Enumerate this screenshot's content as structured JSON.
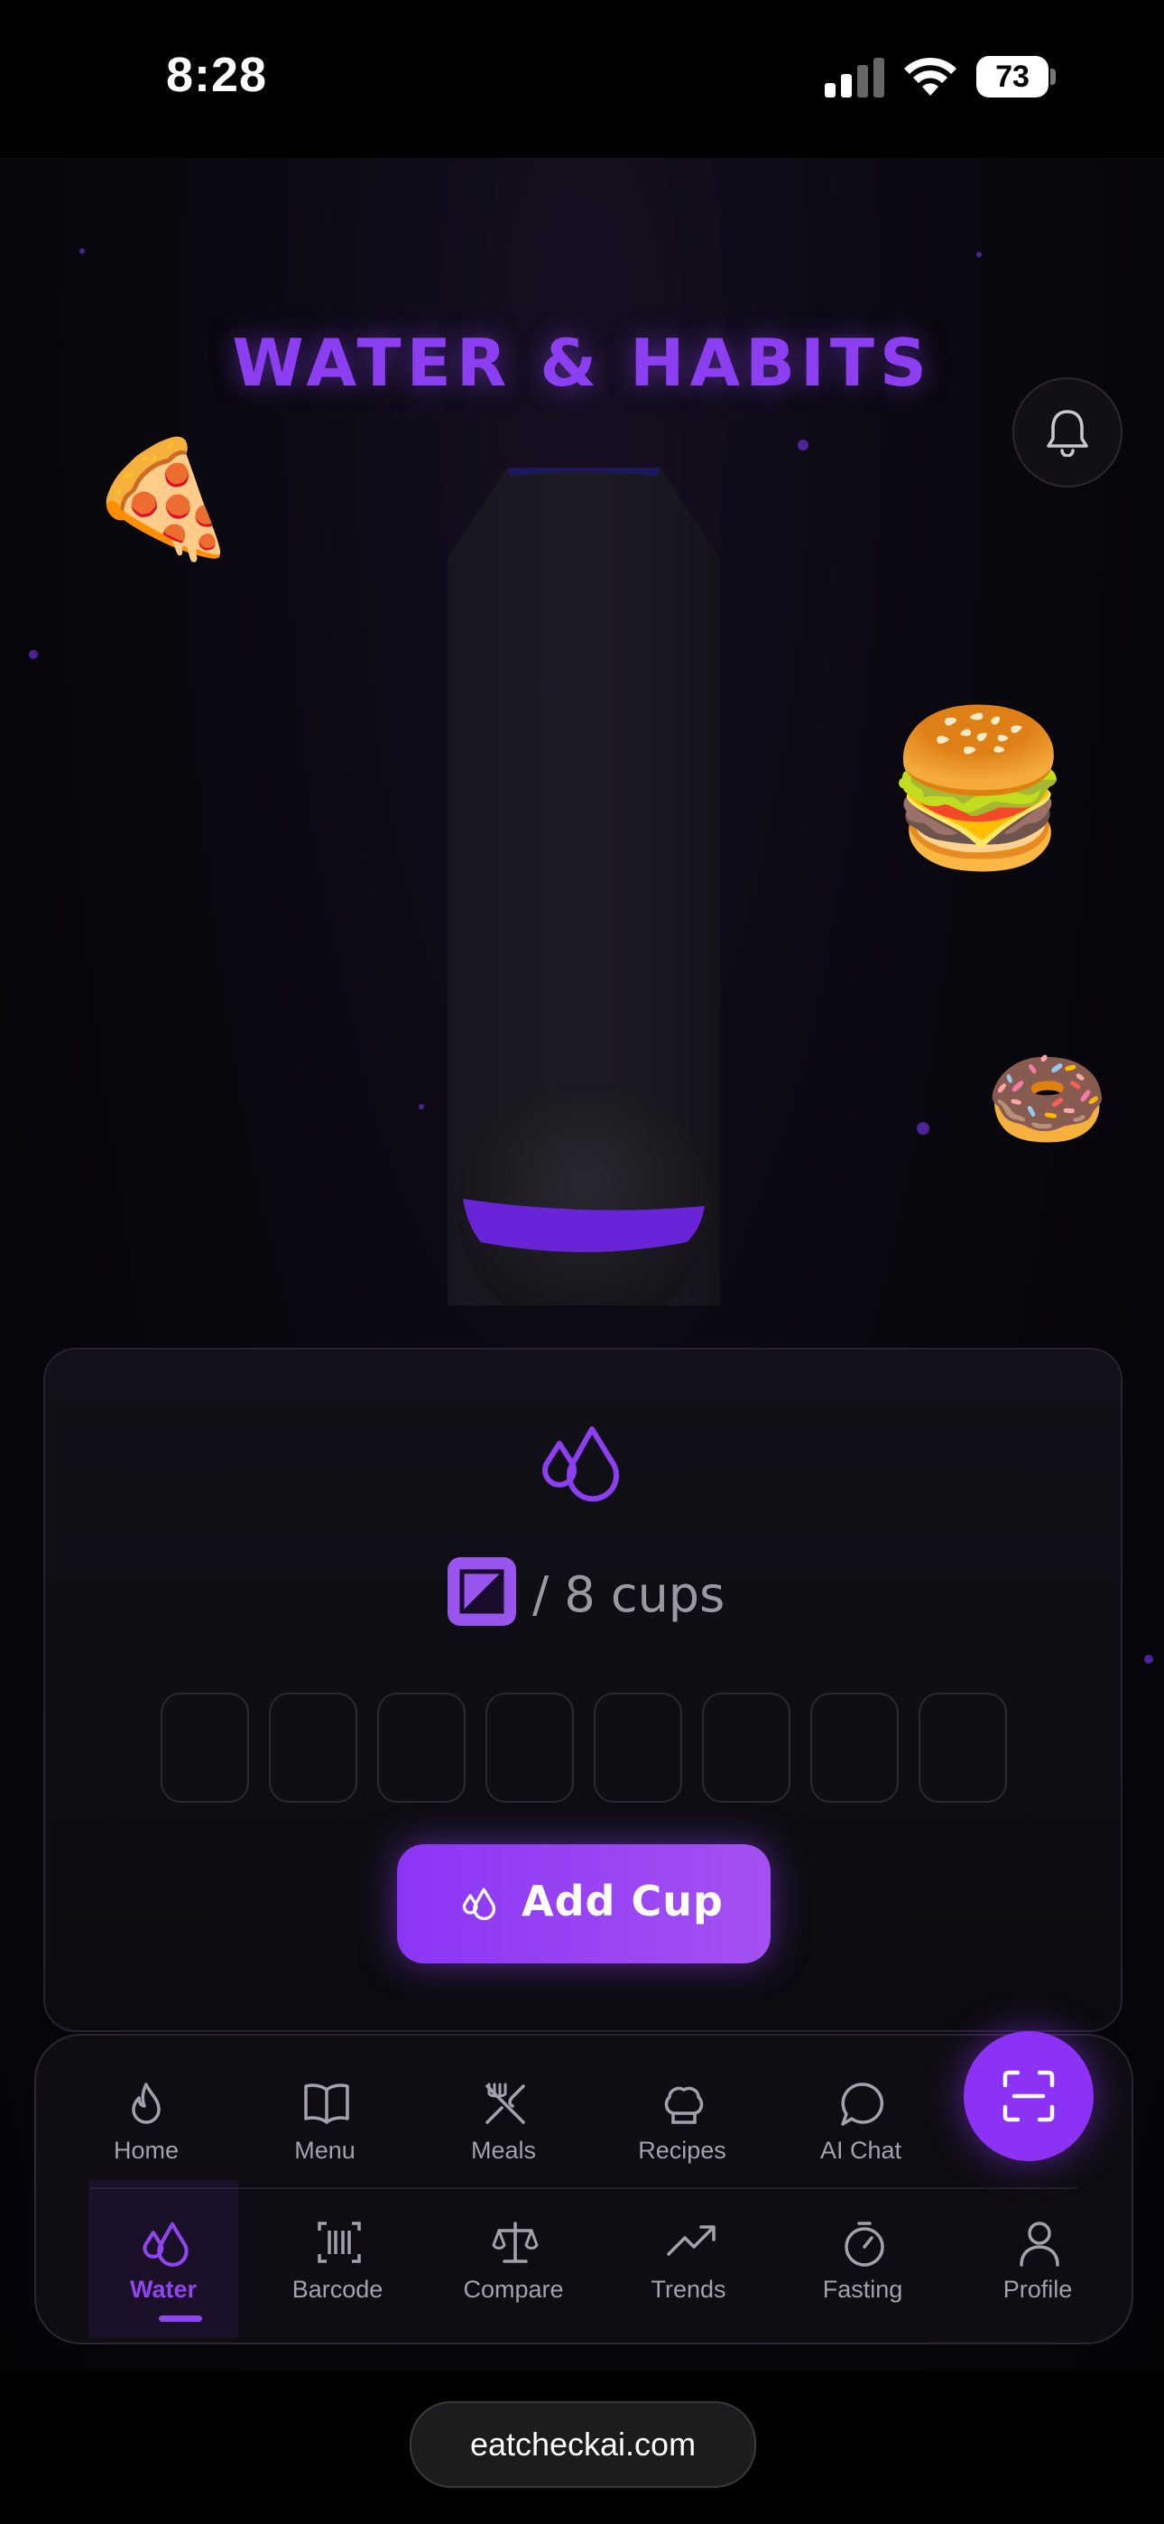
{
  "status_bar": {
    "time": "8:28",
    "battery": "73",
    "icons": [
      "cellular-signal-icon",
      "wifi-icon",
      "battery-icon"
    ]
  },
  "header": {
    "title": "WATER & HABITS",
    "bell_icon": "bell-icon"
  },
  "decorations": [
    "🍕",
    "🍔",
    "🍩",
    "🥑"
  ],
  "bottle": {
    "fill_fraction": 0.0
  },
  "water_card": {
    "icon": "water-drops-icon",
    "count_suffix": "/ 8 cups",
    "total_cups": 8,
    "filled_cups": 0,
    "add_button_label": "Add Cup"
  },
  "nav": {
    "row1": [
      {
        "label": "Home",
        "icon": "flame-icon"
      },
      {
        "label": "Menu",
        "icon": "book-icon"
      },
      {
        "label": "Meals",
        "icon": "utensils-icon"
      },
      {
        "label": "Recipes",
        "icon": "chef-hat-icon"
      },
      {
        "label": "AI Chat",
        "icon": "chat-bubble-icon"
      }
    ],
    "row2": [
      {
        "label": "Water",
        "icon": "water-drops-icon",
        "active": true
      },
      {
        "label": "Barcode",
        "icon": "barcode-icon"
      },
      {
        "label": "Compare",
        "icon": "scale-icon"
      },
      {
        "label": "Trends",
        "icon": "trending-up-icon"
      },
      {
        "label": "Fasting",
        "icon": "timer-icon"
      },
      {
        "label": "Profile",
        "icon": "user-icon"
      }
    ],
    "scan_button_icon": "scan-icon"
  },
  "browser": {
    "url": "eatcheckai.com"
  },
  "colors": {
    "accent": "#8b3ff0",
    "background": "#000000"
  }
}
